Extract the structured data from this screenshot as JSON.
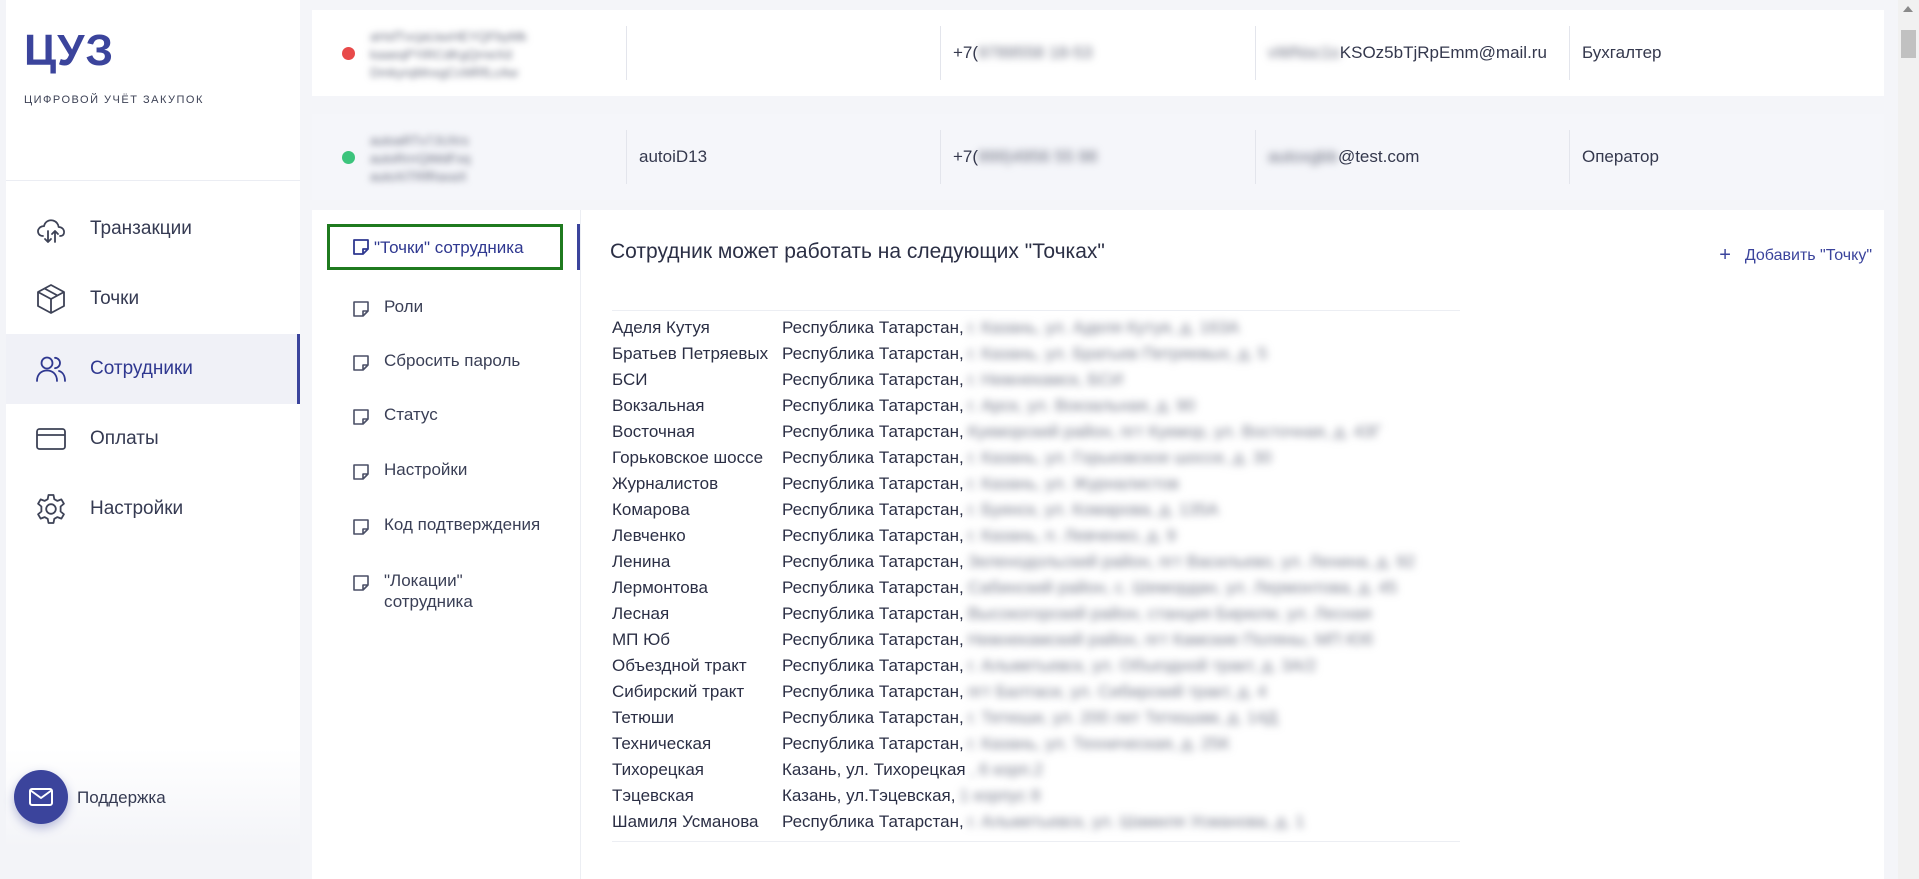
{
  "app": {
    "logo": "ЦУЗ",
    "tagline": "ЦИФРОВОЙ УЧЁТ ЗАКУПОК"
  },
  "nav": [
    {
      "label": "Транзакции",
      "icon": "cloud-sync-icon"
    },
    {
      "label": "Точки",
      "icon": "box-icon"
    },
    {
      "label": "Сотрудники",
      "icon": "users-icon",
      "active": true
    },
    {
      "label": "Оплаты",
      "icon": "card-icon"
    },
    {
      "label": "Настройки",
      "icon": "gear-icon"
    }
  ],
  "support": {
    "label": "Поддержка"
  },
  "employees": [
    {
      "status_color": "#e84a4a",
      "name_lines": [
        "aHsfTvcjaUaxHEYQFbyMk",
        "kaaeqPYiRCdKgQrneXd",
        "DmkyrqMnxgCcMRfLcAw"
      ],
      "login": "",
      "phone_prefix": "+7(",
      "phone_hidden": "9789558 18-53",
      "email_hidden": "vWNsc1s",
      "email_visible": "KSOz5bTjRpEmm@mail.ru",
      "role": "Бухгалтер"
    },
    {
      "status_color": "#3cc47c",
      "name_lines": [
        "autoaRTx7JUXrs",
        "autoRrrrQiMdFxq",
        "autoXiTRfRaxaX"
      ],
      "login": "autoiD13",
      "phone_prefix": "+7(",
      "phone_hidden": "999)4956 55 98",
      "email_hidden": "autoxgbb",
      "email_visible": "@test.com",
      "role": "Оператор"
    }
  ],
  "detail_nav": [
    {
      "label": "\"Точки\" сотрудника",
      "selected": true
    },
    {
      "label": "Роли"
    },
    {
      "label": "Сбросить пароль"
    },
    {
      "label": "Статус"
    },
    {
      "label": "Настройки"
    },
    {
      "label": "Код подтверждения"
    },
    {
      "label": "\"Локации\" сотрудника"
    }
  ],
  "detail": {
    "title": "Сотрудник может работать на следующих \"Точках\"",
    "add_label": "Добавить \"Точку\"",
    "add_icon": "plus-icon"
  },
  "points": [
    {
      "name": "Аделя Кутуя",
      "region": "Республика Татарстан,",
      "hidden": "г. Казань, ул. Аделя Кутуя, д. 163А"
    },
    {
      "name": "Братьев Петряевых",
      "region": "Республика Татарстан,",
      "hidden": "г. Казань, ул. Братьев Петряевых, д. 5"
    },
    {
      "name": "БСИ",
      "region": "Республика Татарстан,",
      "hidden": "г. Нижнекамск, БСИ"
    },
    {
      "name": "Вокзальная",
      "region": "Республика Татарстан,",
      "hidden": "г. Арск, ул. Вокзальная, д. 90"
    },
    {
      "name": "Восточная",
      "region": "Республика Татарстан,",
      "hidden": "Кукморский район, пгт Кукмор, ул. Восточная, д. 43Г"
    },
    {
      "name": "Горьковское шоссе",
      "region": "Республика Татарстан,",
      "hidden": "г. Казань, ул. Горьковское шоссе, д. 30"
    },
    {
      "name": "Журналистов",
      "region": "Республика Татарстан,",
      "hidden": "г. Казань, ул. Журналистов"
    },
    {
      "name": "Комарова",
      "region": "Республика Татарстан,",
      "hidden": "г. Буинск, ул. Комарова, д. 135А"
    },
    {
      "name": "Левченко",
      "region": "Республика Татарстан,",
      "hidden": "г. Казань, п. Левченко, д. 9"
    },
    {
      "name": "Ленина",
      "region": "Республика Татарстан,",
      "hidden": "Зеленодольский район, пгт Васильево, ул. Ленина, д. 92"
    },
    {
      "name": "Лермонтова",
      "region": "Республика Татарстан,",
      "hidden": "Сабинский район, с. Шемордан, ул. Лермонтова, д. 45"
    },
    {
      "name": "Лесная",
      "region": "Республика Татарстан,",
      "hidden": "Высокогорский район, станция Бирюли, ул. Лесная"
    },
    {
      "name": "МП Юб",
      "region": "Республика Татарстан,",
      "hidden": "Нижнекамский район, пгт Камские Поляны, МП Юб"
    },
    {
      "name": "Объездной тракт",
      "region": "Республика Татарстан,",
      "hidden": "г. Альметьевск, ул. Объездной тракт, д. 3А/2"
    },
    {
      "name": "Сибирский тракт",
      "region": "Республика Татарстан,",
      "hidden": "пгт Балтаси, ул. Сибирский тракт, д. 4"
    },
    {
      "name": "Тетюши",
      "region": "Республика Татарстан,",
      "hidden": "г. Тетюши, ул. 200 лет Тетюшам, д. 14Д"
    },
    {
      "name": "Техническая",
      "region": "Республика Татарстан,",
      "hidden": "г. Казань, ул. Техническая, д. 25К"
    },
    {
      "name": "Тихорецкая",
      "region": "Казань, ул. Тихорецкая",
      "hidden": ", 6 корп.2"
    },
    {
      "name": "Тэцевская",
      "region": "Казань, ул.Тэцевская,",
      "hidden": "1 корпус 8"
    },
    {
      "name": "Шамиля Усманова",
      "region": "Республика Татарстан,",
      "hidden": "г. Альметьевск, ул. Шамиля Усманова, д. 1"
    }
  ]
}
